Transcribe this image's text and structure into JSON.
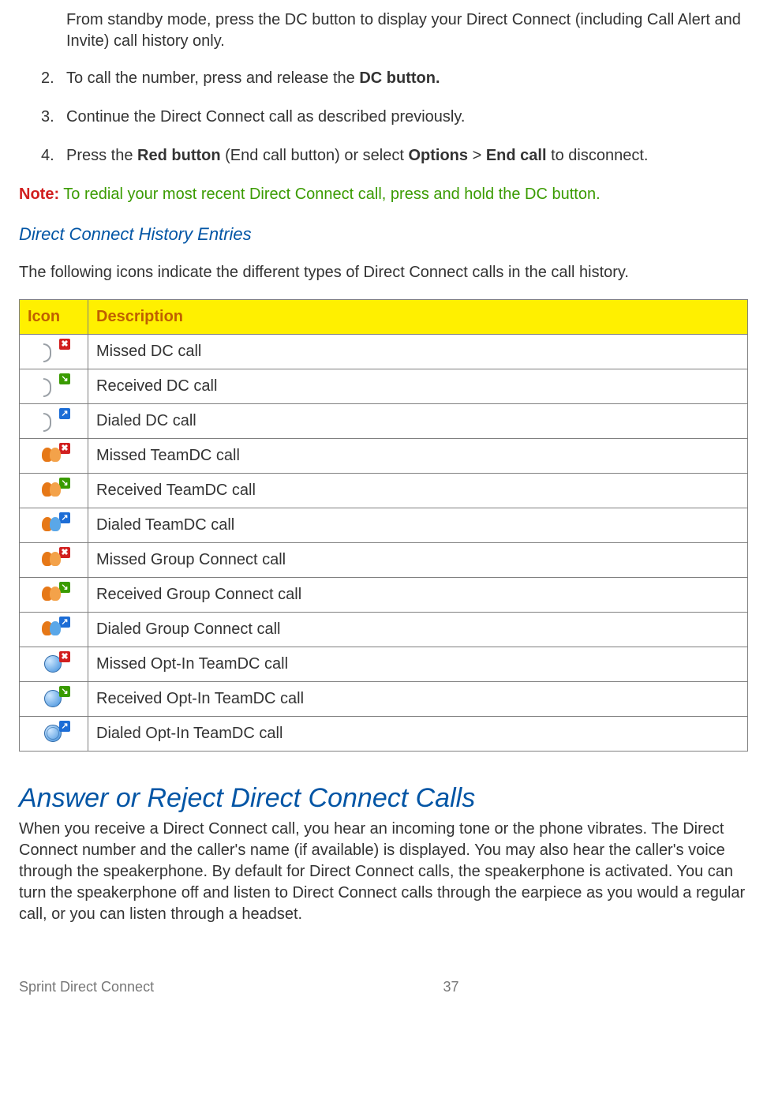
{
  "intro": "From standby mode, press the DC button to display your Direct Connect (including Call Alert and Invite) call history only.",
  "steps": [
    {
      "n": "2.",
      "pre": "To call the number, press and release the ",
      "bold": "DC button."
    },
    {
      "n": "3.",
      "text": "Continue the Direct Connect call as described previously."
    },
    {
      "n": "4.",
      "parts": [
        "Press the ",
        "Red button",
        " (End call button) or select ",
        "Options",
        " > ",
        "End call",
        " to disconnect."
      ]
    }
  ],
  "note": {
    "label": "Note:",
    "text": " To redial your most recent Direct Connect call, press and hold the DC button."
  },
  "history_head": "Direct Connect History Entries",
  "history_desc": "The following icons indicate the different types of Direct Connect calls in the call history.",
  "table": {
    "headers": [
      "Icon",
      "Description"
    ],
    "rows": [
      {
        "icon": "walkie",
        "badge": "red",
        "desc": "Missed DC call"
      },
      {
        "icon": "walkie",
        "badge": "green",
        "desc": "Received DC call"
      },
      {
        "icon": "walkie",
        "badge": "blue",
        "desc": "Dialed DC call"
      },
      {
        "icon": "people",
        "badge": "red",
        "desc": "Missed TeamDC call"
      },
      {
        "icon": "people",
        "badge": "green",
        "desc": "Received TeamDC call"
      },
      {
        "icon": "people blue",
        "badge": "blue",
        "desc": "Dialed TeamDC call"
      },
      {
        "icon": "people",
        "badge": "red",
        "desc": "Missed Group Connect call"
      },
      {
        "icon": "people",
        "badge": "green",
        "desc": "Received Group Connect call"
      },
      {
        "icon": "people blue",
        "badge": "blue",
        "desc": "Dialed Group Connect call"
      },
      {
        "icon": "globe",
        "badge": "red",
        "desc": "Missed Opt-In TeamDC call"
      },
      {
        "icon": "globe",
        "badge": "green",
        "desc": "Received Opt-In TeamDC call"
      },
      {
        "icon": "globe blue",
        "badge": "blue",
        "desc": "Dialed Opt-In TeamDC call"
      }
    ]
  },
  "section_head": "Answer or Reject Direct Connect Calls",
  "section_body": "When you receive a Direct Connect call, you hear an incoming tone or the phone vibrates. The Direct Connect number and the caller's name (if available) is displayed. You may also hear the caller's voice through the speakerphone. By default for Direct Connect calls, the speakerphone is activated. You can turn the speakerphone off and listen to Direct Connect calls through the earpiece as you would a regular call, or you can listen through a headset.",
  "footer": {
    "left": "Sprint Direct Connect",
    "page": "37"
  }
}
